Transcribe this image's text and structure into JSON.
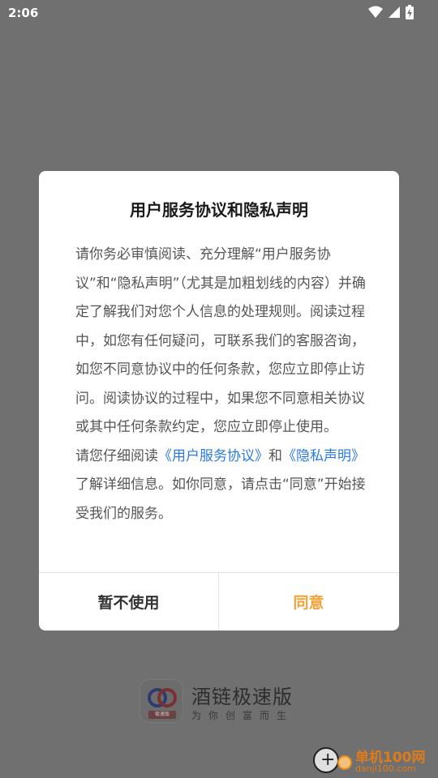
{
  "status_bar": {
    "time": "2:06",
    "icons": [
      "wifi-icon",
      "signal-icon",
      "battery-charging-icon"
    ]
  },
  "dialog": {
    "title": "用户服务协议和隐私声明",
    "paragraph1": "请你务必审慎阅读、充分理解“用户服务协议”和“隐私声明”（尤其是加粗划线的内容）并确定了解我们对您个人信息的处理规则。阅读过程中，如您有任何疑问，可联系我们的客服咨询，如您不同意协议中的任何条款，您应立即停止访问。阅读协议的过程中，如果您不同意相关协议或其中任何条款约定，您应立即停止使用。",
    "paragraph2": {
      "prefix": "请您仔细阅读",
      "link_terms": "《用户服务协议》",
      "middle": "和",
      "link_privacy": "《隐私声明》",
      "suffix": "了解详细信息。如你同意，请点击“同意”开始接受我们的服务。"
    },
    "decline_label": "暂不使用",
    "agree_label": "同意"
  },
  "brand": {
    "name": "酒链极速版",
    "slogan": "为你创富而生",
    "logo_tag": "极速版"
  },
  "watermark": {
    "name": "单机100网",
    "url": "danji100.com"
  },
  "colors": {
    "overlay": "#707070",
    "link": "#2a7ae2",
    "agree": "#f5a13a"
  }
}
